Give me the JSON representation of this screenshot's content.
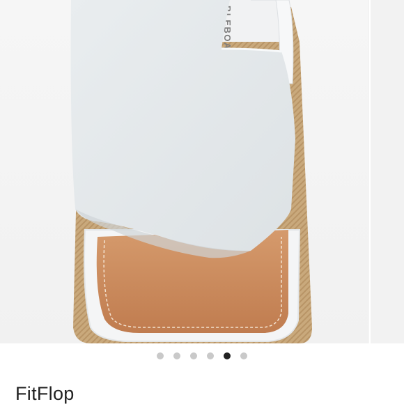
{
  "product": {
    "brand": "FitFlop",
    "insole_print": "BLEBOARD TE"
  },
  "gallery": {
    "image_count": 6,
    "active_index": 4,
    "colors": {
      "upper": "#e4e8ea",
      "footbed": "#c98a5c",
      "jute": "#c9a97c",
      "sole_trim": "#f4f5f6",
      "dot_inactive": "#c9c9c9",
      "dot_active": "#222222"
    }
  }
}
